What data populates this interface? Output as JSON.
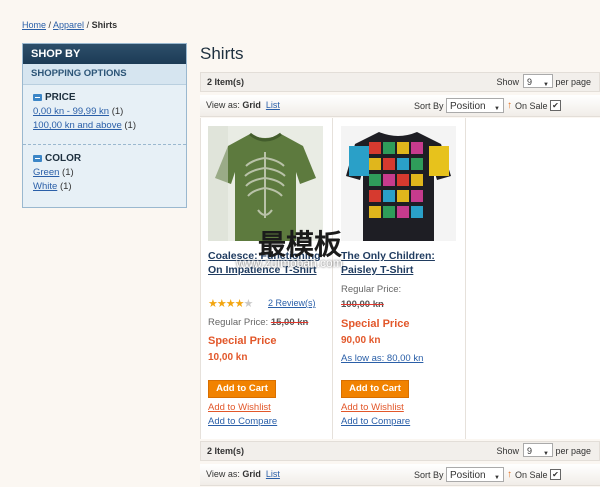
{
  "breadcrumb": {
    "home": "Home",
    "sep1": " / ",
    "category": "Apparel",
    "sep2": " / ",
    "current": "Shirts"
  },
  "sidebar": {
    "title": "SHOP BY",
    "subtitle": "SHOPPING OPTIONS",
    "price": {
      "title": "PRICE",
      "options": [
        {
          "label": "0,00 kn - 99,99 kn",
          "count": "(1)"
        },
        {
          "label": "100,00 kn and above",
          "count": "(1)"
        }
      ]
    },
    "color": {
      "title": "COLOR",
      "options": [
        {
          "label": "Green",
          "count": "(1)"
        },
        {
          "label": "White",
          "count": "(1)"
        }
      ]
    }
  },
  "page_title": "Shirts",
  "toolbar": {
    "items_count": "2 Item(s)",
    "show_label": "Show",
    "per_page_value": "9",
    "per_page_label": "per page",
    "view_as_label": "View as:",
    "view_grid": "Grid",
    "view_list": "List",
    "sort_by_label": "Sort By",
    "sort_value": "Position",
    "sort_direction_icon": "↑",
    "on_sale_label": "On Sale",
    "on_sale_checked": "✔"
  },
  "products": [
    {
      "name": "Coalesce: Functioning On Impatience T-Shirt",
      "rating_stars": 4,
      "reviews": "2 Review(s)",
      "regular_label": "Regular Price:",
      "regular_price": "15,00 kn",
      "special_label": "Special Price",
      "special_price": "10,00 kn",
      "add_to_cart": "Add to Cart",
      "add_to_wishlist": "Add to Wishlist",
      "add_to_compare": "Add to Compare"
    },
    {
      "name": "The Only Children: Paisley T-Shirt",
      "regular_label": "Regular Price:",
      "regular_price": "100,00 kn",
      "special_label": "Special Price",
      "special_price": "90,00 kn",
      "as_low_as": "As low as: 80,00 kn",
      "add_to_cart": "Add to Cart",
      "add_to_wishlist": "Add to Wishlist",
      "add_to_compare": "Add to Compare"
    }
  ],
  "watermark": {
    "text_cn": "最模板",
    "url": "www.zuimoban.com"
  },
  "colors": {
    "accent_orange": "#f18200",
    "link_blue": "#2a5fa8",
    "special_red": "#e2572a",
    "sidebar_head": "#1c3b55"
  }
}
